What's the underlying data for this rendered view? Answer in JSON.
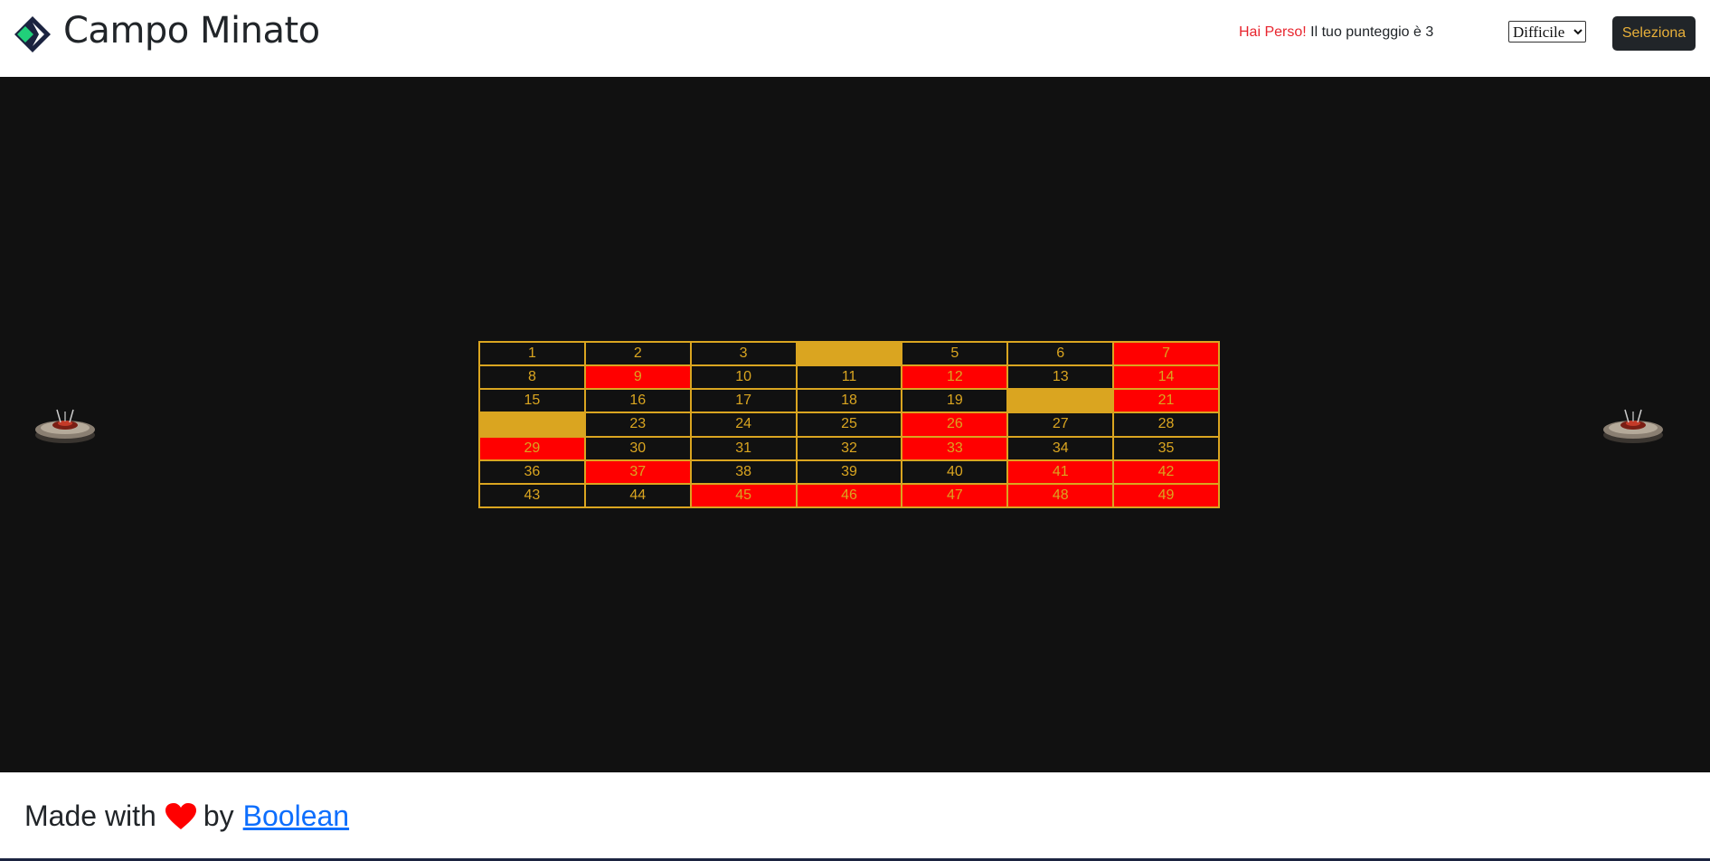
{
  "header": {
    "title": "Campo Minato",
    "status_lost": "Hai Perso!",
    "status_score": " Il tuo punteggio è 3",
    "difficulty_selected": "Difficile",
    "select_button": "Seleziona"
  },
  "colors": {
    "board_bg": "#111111",
    "cell_border": "#daa520",
    "bomb": "#ff0000",
    "revealed_safe": "#daa520",
    "button_bg": "#212529",
    "link": "#0d6efd"
  },
  "icons": {
    "logo": "diamond-chevron-logo-icon",
    "mine": "landmine-icon",
    "heart": "heart-icon"
  },
  "grid": {
    "columns": 7,
    "rows": 7,
    "cells": [
      {
        "n": "1",
        "s": "hidden"
      },
      {
        "n": "2",
        "s": "hidden"
      },
      {
        "n": "3",
        "s": "hidden"
      },
      {
        "n": "",
        "s": "safe"
      },
      {
        "n": "5",
        "s": "hidden"
      },
      {
        "n": "6",
        "s": "hidden"
      },
      {
        "n": "7",
        "s": "bomb"
      },
      {
        "n": "8",
        "s": "hidden"
      },
      {
        "n": "9",
        "s": "bomb"
      },
      {
        "n": "10",
        "s": "hidden"
      },
      {
        "n": "11",
        "s": "hidden"
      },
      {
        "n": "12",
        "s": "bomb"
      },
      {
        "n": "13",
        "s": "hidden"
      },
      {
        "n": "14",
        "s": "bomb"
      },
      {
        "n": "15",
        "s": "hidden"
      },
      {
        "n": "16",
        "s": "hidden"
      },
      {
        "n": "17",
        "s": "hidden"
      },
      {
        "n": "18",
        "s": "hidden"
      },
      {
        "n": "19",
        "s": "hidden"
      },
      {
        "n": "",
        "s": "safe"
      },
      {
        "n": "21",
        "s": "bomb"
      },
      {
        "n": "",
        "s": "safe"
      },
      {
        "n": "23",
        "s": "hidden"
      },
      {
        "n": "24",
        "s": "hidden"
      },
      {
        "n": "25",
        "s": "hidden"
      },
      {
        "n": "26",
        "s": "bomb"
      },
      {
        "n": "27",
        "s": "hidden"
      },
      {
        "n": "28",
        "s": "hidden"
      },
      {
        "n": "29",
        "s": "bomb"
      },
      {
        "n": "30",
        "s": "hidden"
      },
      {
        "n": "31",
        "s": "hidden"
      },
      {
        "n": "32",
        "s": "hidden"
      },
      {
        "n": "33",
        "s": "bomb"
      },
      {
        "n": "34",
        "s": "hidden"
      },
      {
        "n": "35",
        "s": "hidden"
      },
      {
        "n": "36",
        "s": "hidden"
      },
      {
        "n": "37",
        "s": "bomb"
      },
      {
        "n": "38",
        "s": "hidden"
      },
      {
        "n": "39",
        "s": "hidden"
      },
      {
        "n": "40",
        "s": "hidden"
      },
      {
        "n": "41",
        "s": "bomb"
      },
      {
        "n": "42",
        "s": "bomb"
      },
      {
        "n": "43",
        "s": "hidden"
      },
      {
        "n": "44",
        "s": "hidden"
      },
      {
        "n": "45",
        "s": "bomb"
      },
      {
        "n": "46",
        "s": "bomb"
      },
      {
        "n": "47",
        "s": "bomb"
      },
      {
        "n": "48",
        "s": "bomb"
      },
      {
        "n": "49",
        "s": "bomb"
      }
    ]
  },
  "footer": {
    "made_with": "Made with",
    "by": "by",
    "link_text": "Boolean"
  }
}
